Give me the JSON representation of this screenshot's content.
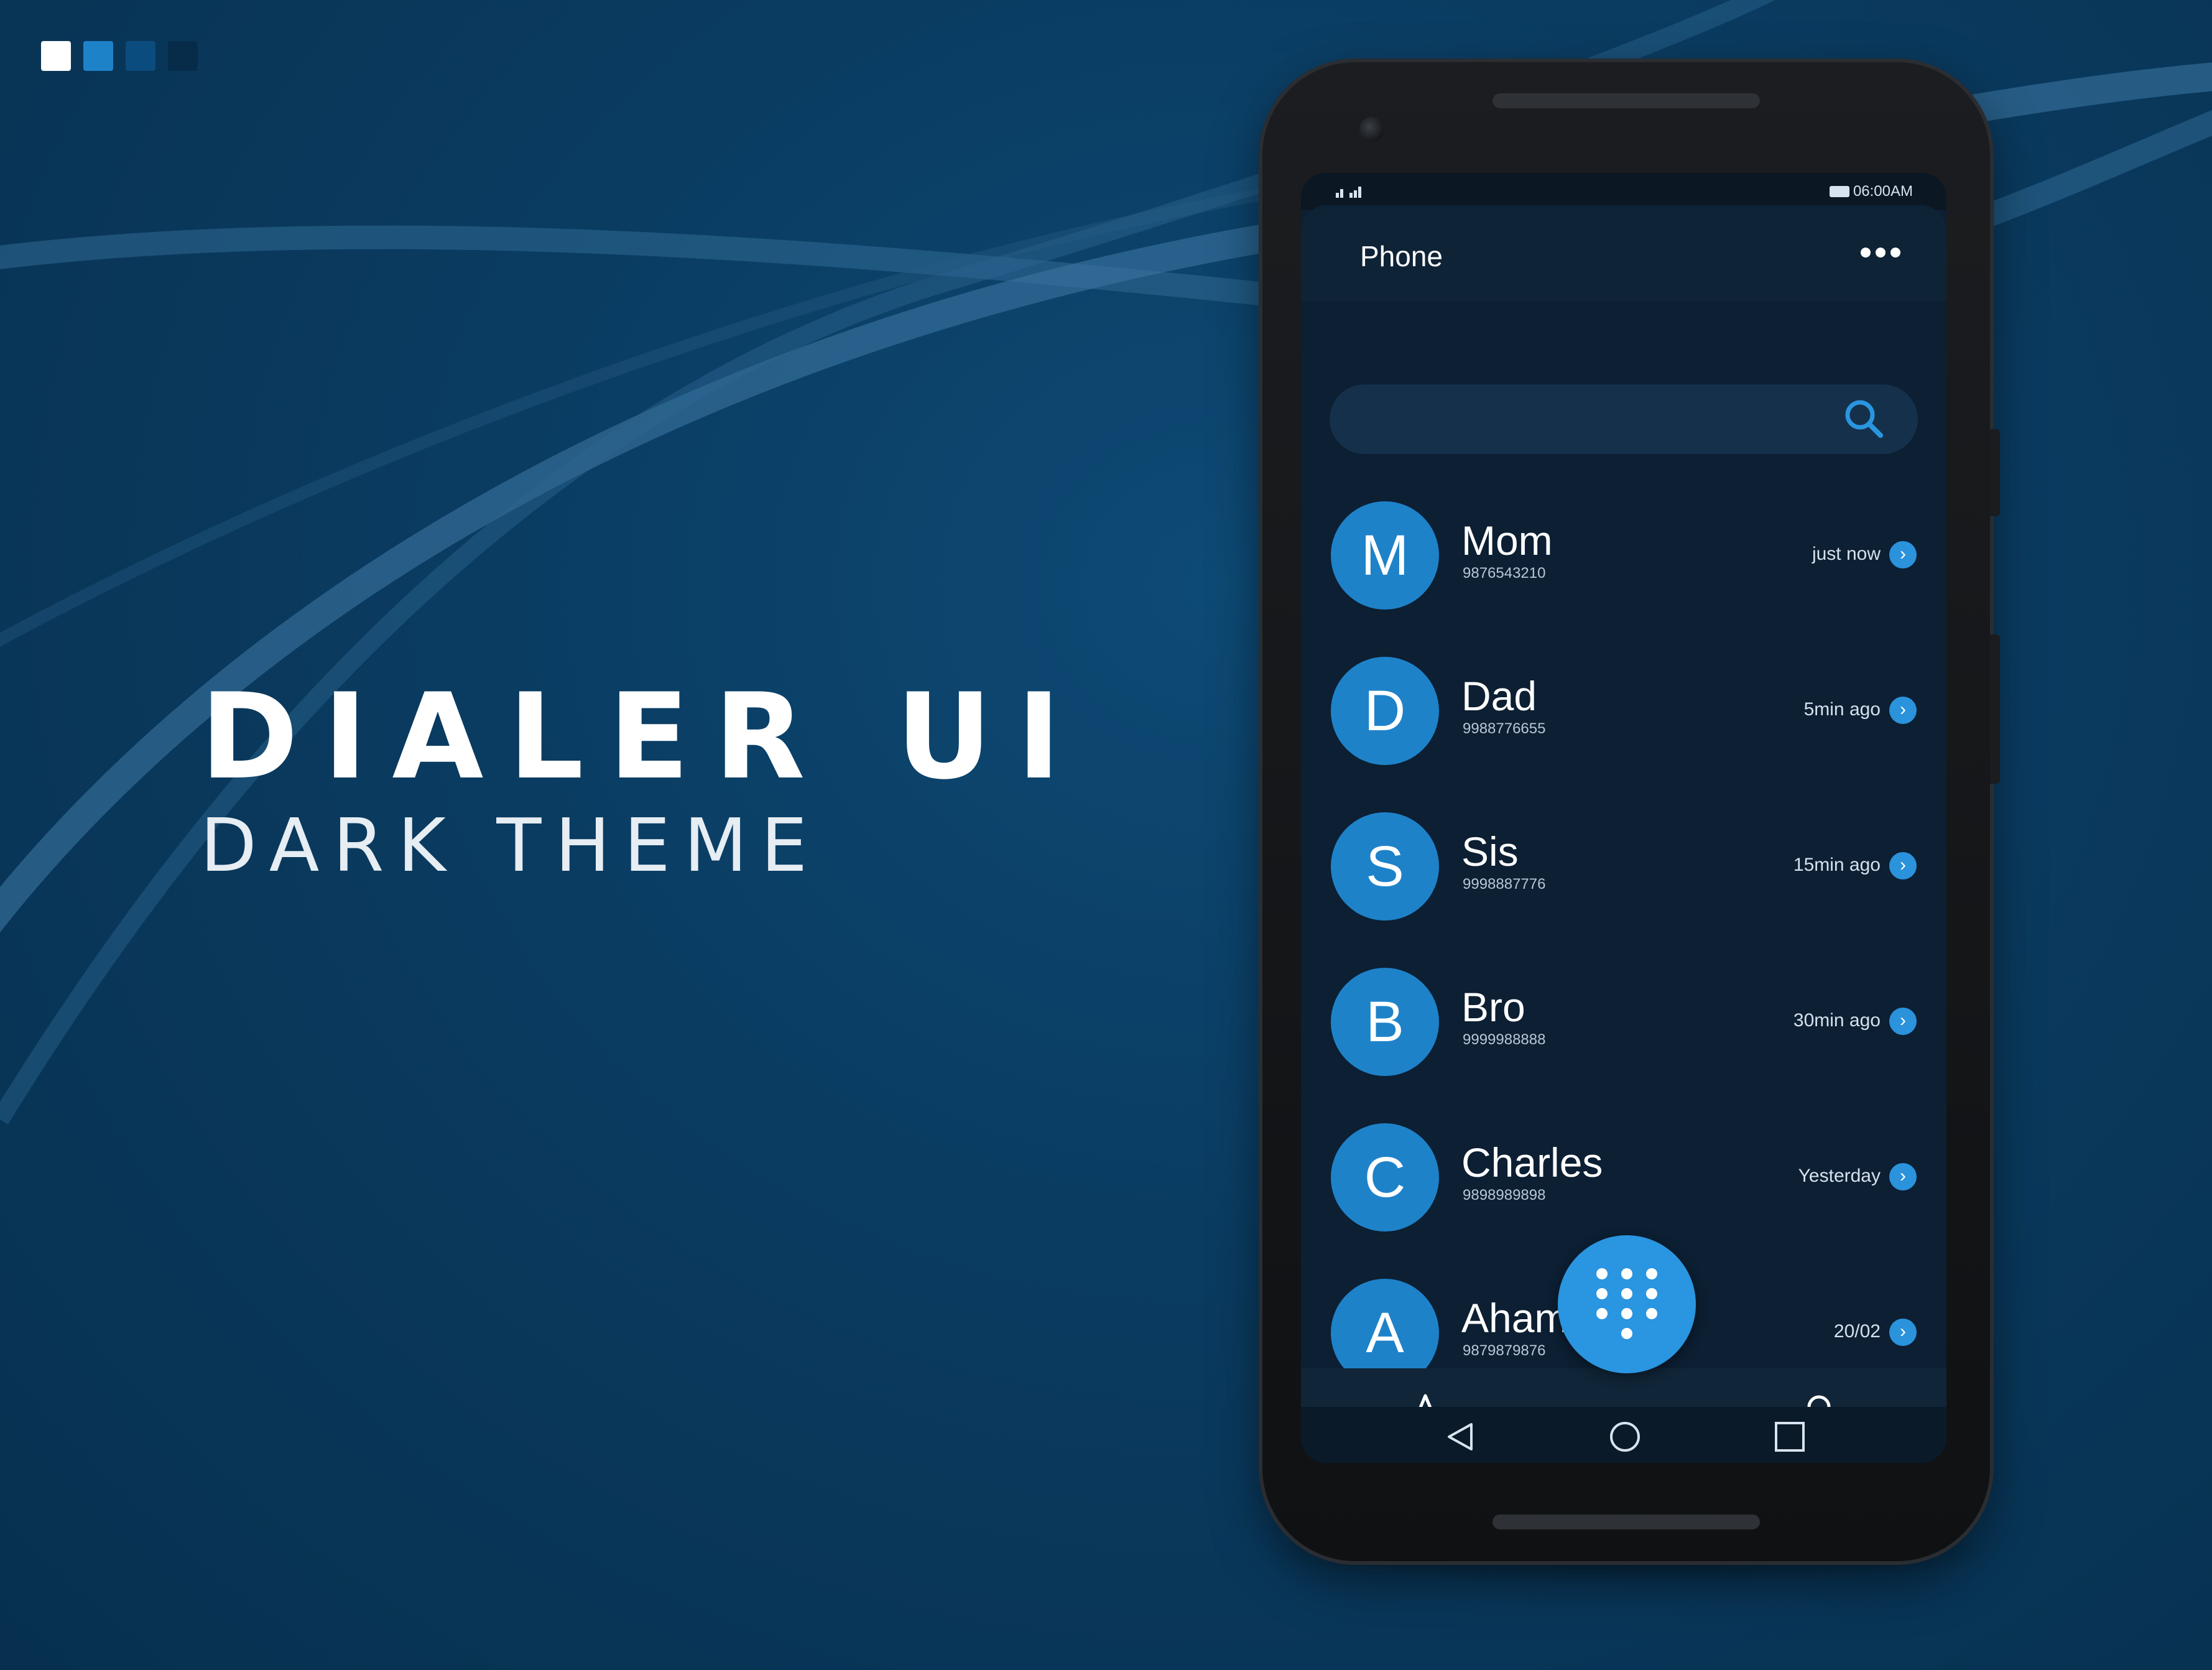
{
  "brand_squares": [
    "#ffffff",
    "#1e82c9",
    "#0b4c7e",
    "#062c49"
  ],
  "hero": {
    "title": "DIALER UI",
    "subtitle": "DARK THEME"
  },
  "status_bar": {
    "time": "06:00AM"
  },
  "app": {
    "title": "Phone",
    "more_icon": "more-horizontal-icon"
  },
  "search": {
    "placeholder": "",
    "icon": "search-icon"
  },
  "contacts": [
    {
      "initial": "M",
      "name": "Mom",
      "number": "9876543210",
      "time": "just now"
    },
    {
      "initial": "D",
      "name": "Dad",
      "number": "9988776655",
      "time": "5min ago"
    },
    {
      "initial": "S",
      "name": "Sis",
      "number": "9998887776",
      "time": "15min ago"
    },
    {
      "initial": "B",
      "name": "Bro",
      "number": "9999988888",
      "time": "30min ago"
    },
    {
      "initial": "C",
      "name": "Charles",
      "number": "9898989898",
      "time": "Yesterday"
    },
    {
      "initial": "A",
      "name": "Aham",
      "number": "9879879876",
      "time": "20/02"
    }
  ],
  "bottom_nav": {
    "left_icon": "star-icon",
    "center_icon": "dialpad-icon",
    "right_icon": "person-icon"
  },
  "system_nav": {
    "back": "back-triangle-icon",
    "home": "home-circle-icon",
    "recents": "recents-square-icon"
  },
  "colors": {
    "accent": "#2a95e0",
    "avatar": "#1e82c9",
    "background": "#0a3b60",
    "screen": "#0c1f33"
  }
}
